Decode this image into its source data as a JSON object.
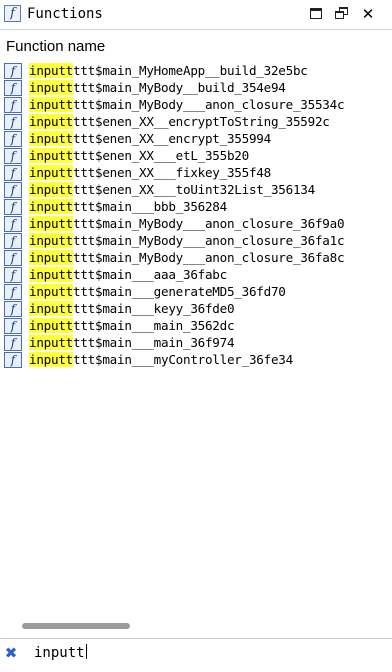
{
  "window": {
    "title": "Functions",
    "icon": "function-icon",
    "buttons": [
      "maximize-icon",
      "restore-icon",
      "close-icon"
    ],
    "close_glyph": "✕"
  },
  "table": {
    "column_header": "Function name",
    "icon_glyph": "f",
    "highlight_color": "#ffff3a",
    "rows": [
      {
        "match": "inputt",
        "rest": "ttt$main_MyHomeApp__build_32e5bc"
      },
      {
        "match": "inputt",
        "rest": "ttt$main_MyBody__build_354e94"
      },
      {
        "match": "inputt",
        "rest": "ttt$main_MyBody___anon_closure_35534c"
      },
      {
        "match": "inputt",
        "rest": "ttt$enen_XX__encryptToString_35592c"
      },
      {
        "match": "inputt",
        "rest": "ttt$enen_XX__encrypt_355994"
      },
      {
        "match": "inputt",
        "rest": "ttt$enen_XX___etL_355b20"
      },
      {
        "match": "inputt",
        "rest": "ttt$enen_XX___fixkey_355f48"
      },
      {
        "match": "inputt",
        "rest": "ttt$enen_XX___toUint32List_356134"
      },
      {
        "match": "inputt",
        "rest": "ttt$main___bbb_356284"
      },
      {
        "match": "inputt",
        "rest": "ttt$main_MyBody___anon_closure_36f9a0"
      },
      {
        "match": "inputt",
        "rest": "ttt$main_MyBody___anon_closure_36fa1c"
      },
      {
        "match": "inputt",
        "rest": "ttt$main_MyBody___anon_closure_36fa8c"
      },
      {
        "match": "inputt",
        "rest": "ttt$main___aaa_36fabc"
      },
      {
        "match": "inputt",
        "rest": "ttt$main___generateMD5_36fd70"
      },
      {
        "match": "inputt",
        "rest": "ttt$main___keyy_36fde0"
      },
      {
        "match": "inputt",
        "rest": "ttt$main___main_3562dc"
      },
      {
        "match": "inputt",
        "rest": "ttt$main___main_36f974"
      },
      {
        "match": "inputt",
        "rest": "ttt$main___myController_36fe34"
      }
    ]
  },
  "filter": {
    "value": "inputt",
    "clear_icon": "clear-filter-icon",
    "clear_glyph": "✖"
  }
}
